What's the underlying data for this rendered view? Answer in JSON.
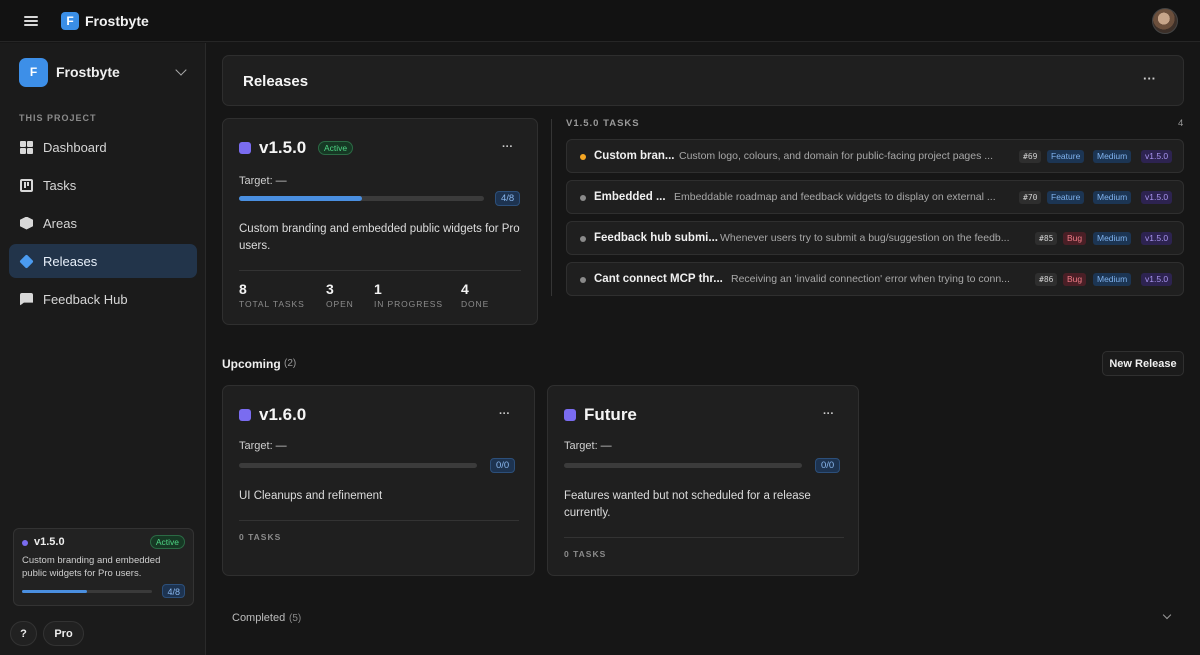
{
  "topbar": {
    "brand": "Frostbyte",
    "brand_initial": "F"
  },
  "sidebar": {
    "project_name": "Frostbyte",
    "project_initial": "F",
    "section_label": "THIS PROJECT",
    "items": [
      {
        "label": "Dashboard",
        "icon": "dashboard-icon"
      },
      {
        "label": "Tasks",
        "icon": "kanban-icon"
      },
      {
        "label": "Areas",
        "icon": "cube-icon"
      },
      {
        "label": "Releases",
        "icon": "layers-icon",
        "active": true
      },
      {
        "label": "Feedback Hub",
        "icon": "chat-icon"
      }
    ],
    "current_release": {
      "version": "v1.5.0",
      "status": "Active",
      "description": "Custom branding and embedded public widgets for Pro users.",
      "progress": "4/8",
      "progress_fraction": 0.5
    },
    "help_label": "?",
    "plan_label": "Pro"
  },
  "page": {
    "title": "Releases",
    "menu": "···"
  },
  "active_release": {
    "version": "v1.5.0",
    "status": "Active",
    "target": "Target: —",
    "progress": "4/8",
    "progress_fraction": 0.5,
    "description": "Custom branding and embedded public widgets for Pro users.",
    "stats": [
      {
        "value": "8",
        "label": "TOTAL TASKS"
      },
      {
        "value": "3",
        "label": "OPEN"
      },
      {
        "value": "1",
        "label": "IN PROGRESS"
      },
      {
        "value": "4",
        "label": "DONE"
      }
    ],
    "menu": "···",
    "swatch_color": "#7a6cf0"
  },
  "task_panel": {
    "heading": "V1.5.0 TASKS",
    "count": "4",
    "tasks": [
      {
        "title": "Custom bran...",
        "description": "Custom logo, colours, and domain for public-facing project pages ...",
        "id": "#69",
        "type": "Feature",
        "priority": "Medium",
        "version": "v1.5.0",
        "status_color": "#f5a623"
      },
      {
        "title": "Embedded ...",
        "description": "Embeddable roadmap and feedback widgets to display on external ...",
        "id": "#70",
        "type": "Feature",
        "priority": "Medium",
        "version": "v1.5.0",
        "status_color": "#8a8a8a"
      },
      {
        "title": "Feedback hub submi...",
        "description": "Whenever users try to submit a bug/suggestion on the feedb...",
        "id": "#85",
        "type": "Bug",
        "priority": "Medium",
        "version": "v1.5.0",
        "status_color": "#8a8a8a"
      },
      {
        "title": "Cant connect MCP thr...",
        "description": "Receiving an 'invalid connection' error when trying to conn...",
        "id": "#86",
        "type": "Bug",
        "priority": "Medium",
        "version": "v1.5.0",
        "status_color": "#8a8a8a"
      }
    ]
  },
  "upcoming": {
    "label": "Upcoming",
    "count": "(2)",
    "new_release_label": "New Release",
    "releases": [
      {
        "version": "v1.6.0",
        "target": "Target: —",
        "progress": "0/0",
        "progress_fraction": 0,
        "description": "UI Cleanups and refinement",
        "tasks_label": "0 TASKS",
        "menu": "···"
      },
      {
        "version": "Future",
        "target": "Target: —",
        "progress": "0/0",
        "progress_fraction": 0,
        "description": "Features wanted but not scheduled for a release currently.",
        "tasks_label": "0 TASKS",
        "menu": "···"
      }
    ]
  },
  "completed": {
    "label": "Completed",
    "count": "(5)"
  },
  "colors": {
    "accent": "#4a8fe0",
    "release_swatch": "#7a6cf0",
    "active_green": "#4fd685",
    "bug_red": "#f07b86"
  }
}
